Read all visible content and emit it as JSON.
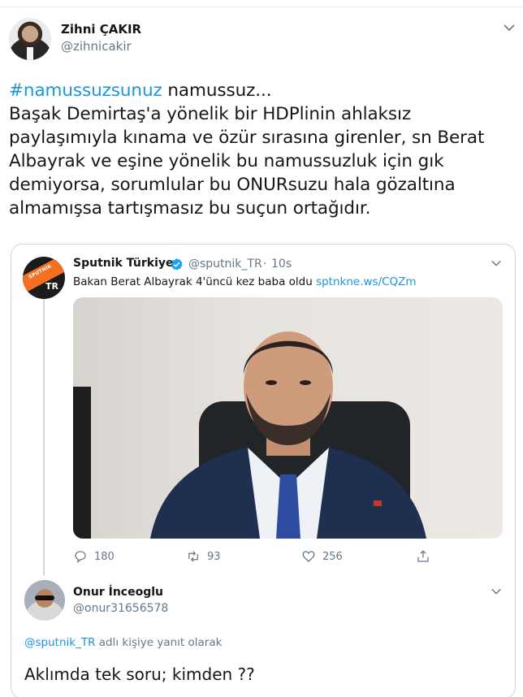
{
  "main_tweet": {
    "author_name": "Zihni ÇAKIR",
    "author_handle": "@zihnicakir",
    "hashtag": "#namussuzsunuz",
    "text_line1_rest": " namussuz...",
    "text_lines": [
      "Başak Demirtaş'a yönelik bir HDPlinin ahlaksız",
      "paylaşımıyla kınama ve özür sırasına girenler, sn Berat",
      "Albayrak ve eşine yönelik bu namussuzluk için gık",
      "demiyorsa, sorumlular bu ONURsuzu hala gözaltına",
      "almamışsa tartışmasız bu suçun ortağıdır."
    ]
  },
  "quoted_tweet": {
    "author_name": "Sputnik Türkiye",
    "author_handle": "@sputnik_TR",
    "separator": "·",
    "timestamp": "10s",
    "text": "Bakan Berat Albayrak 4'üncü kez baba oldu ",
    "link": "sptnkne.ws/CQZm",
    "avatar_text_logo": "SPUTNIK",
    "avatar_text_tr": "TR",
    "actions": {
      "replies": "180",
      "retweets": "93",
      "likes": "256"
    }
  },
  "reply": {
    "author_name": "Onur İnceoglu",
    "author_handle": "@onur31656578",
    "reply_to_mention": "@sputnik_TR",
    "reply_to_suffix": " adlı kişiye yanıt olarak",
    "text": "Aklımda tek soru;  kimden ??"
  },
  "colors": {
    "link": "#1b95e0",
    "secondary_text": "#657786",
    "border": "#ccd6dd"
  },
  "icons": [
    "chevron-down-icon",
    "verified-badge-icon",
    "reply-icon",
    "retweet-icon",
    "like-icon",
    "share-icon"
  ]
}
